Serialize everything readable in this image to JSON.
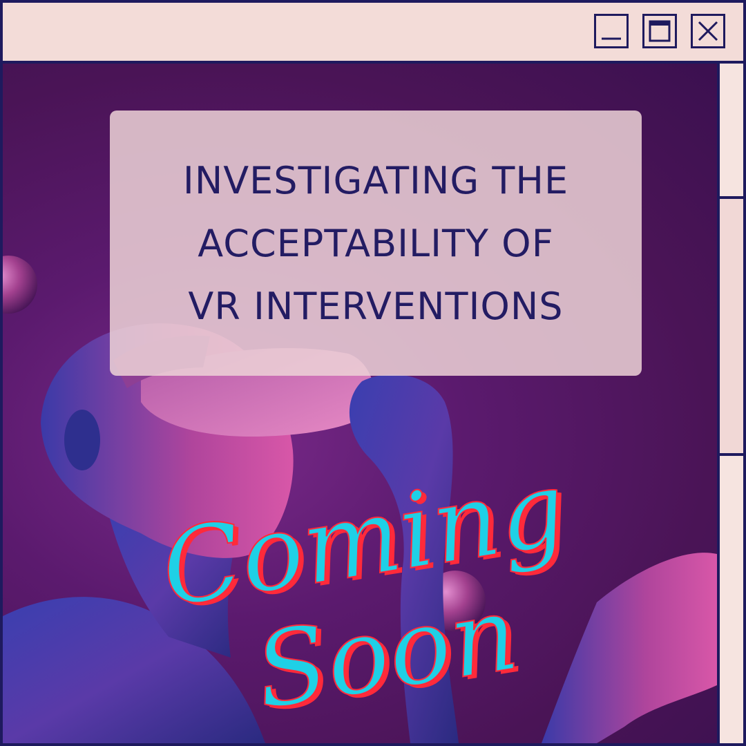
{
  "window": {
    "controls": {
      "minimize_icon": "minimize-icon",
      "maximize_icon": "maximize-icon",
      "close_icon": "close-icon"
    },
    "colors": {
      "frame": "#1e1a5e",
      "titlebar": "#f3dcd8",
      "background": "#5b1a6e",
      "panel": "#ecd2d6",
      "heading_text": "#231c63",
      "script_fill": "#1fd0e6",
      "script_shadow": "#ff2a3a"
    }
  },
  "headline": {
    "line1": "INVESTIGATING THE",
    "line2": "ACCEPTABILITY OF",
    "line3": "VR INTERVENTIONS"
  },
  "script": {
    "word1": "Coming",
    "word2": "Soon"
  }
}
